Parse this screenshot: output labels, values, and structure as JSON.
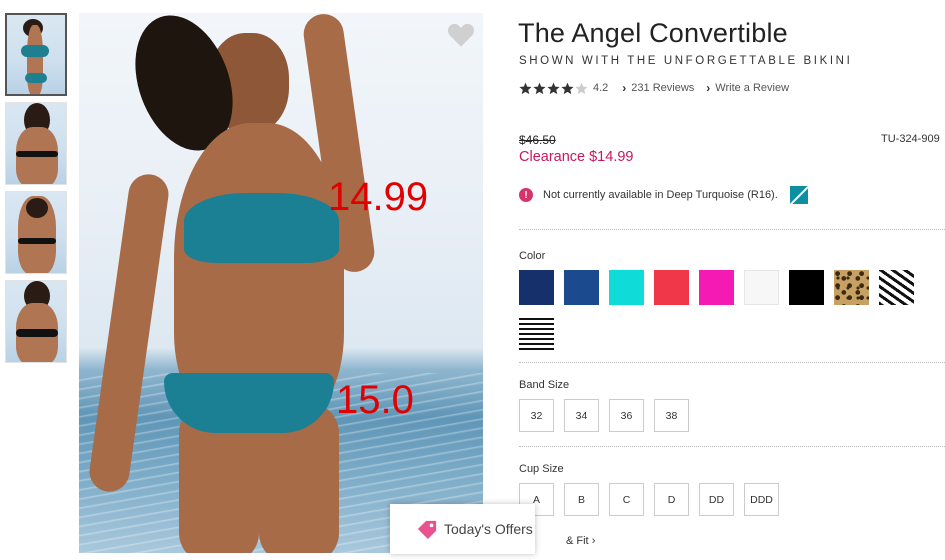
{
  "product": {
    "title": "The Angel Convertible",
    "subtitle": "SHOWN WITH THE UNFORGETTABLE BIKINI",
    "rating_value": "4.2",
    "rating_stars": 4.2,
    "reviews_link": "231 Reviews",
    "write_review_link": "Write a Review",
    "old_price": "$46.50",
    "clearance_price": "Clearance $14.99",
    "sku": "TU-324-909"
  },
  "availability": {
    "message": "Not currently available in Deep Turquoise (R16).",
    "icon": "alert-icon",
    "swatch_color": "#0e8ea3"
  },
  "image_overlay": {
    "top_price": "14.99",
    "bottom_price": "15.0",
    "color": "#e00000"
  },
  "color": {
    "label": "Color",
    "swatches": [
      {
        "name": "navy",
        "color": "#15306b"
      },
      {
        "name": "royal-blue",
        "color": "#1c4a8e"
      },
      {
        "name": "aqua",
        "color": "#0fdcd9"
      },
      {
        "name": "coral-red",
        "color": "#f0374a"
      },
      {
        "name": "hot-pink",
        "color": "#f51ab4"
      },
      {
        "name": "white",
        "color": "#f7f7f7"
      },
      {
        "name": "black",
        "color": "#000000"
      },
      {
        "name": "leopard",
        "color": "#c7a064"
      },
      {
        "name": "zebra",
        "color": "#222222"
      },
      {
        "name": "stripe",
        "color": "#111111"
      }
    ]
  },
  "band_size": {
    "label": "Band Size",
    "options": [
      "32",
      "34",
      "36",
      "38"
    ]
  },
  "cup_size": {
    "label": "Cup Size",
    "options": [
      "A",
      "B",
      "C",
      "D",
      "DD",
      "DDD"
    ]
  },
  "size_fit_link": "& Fit",
  "offers": {
    "label": "Today's Offers"
  }
}
